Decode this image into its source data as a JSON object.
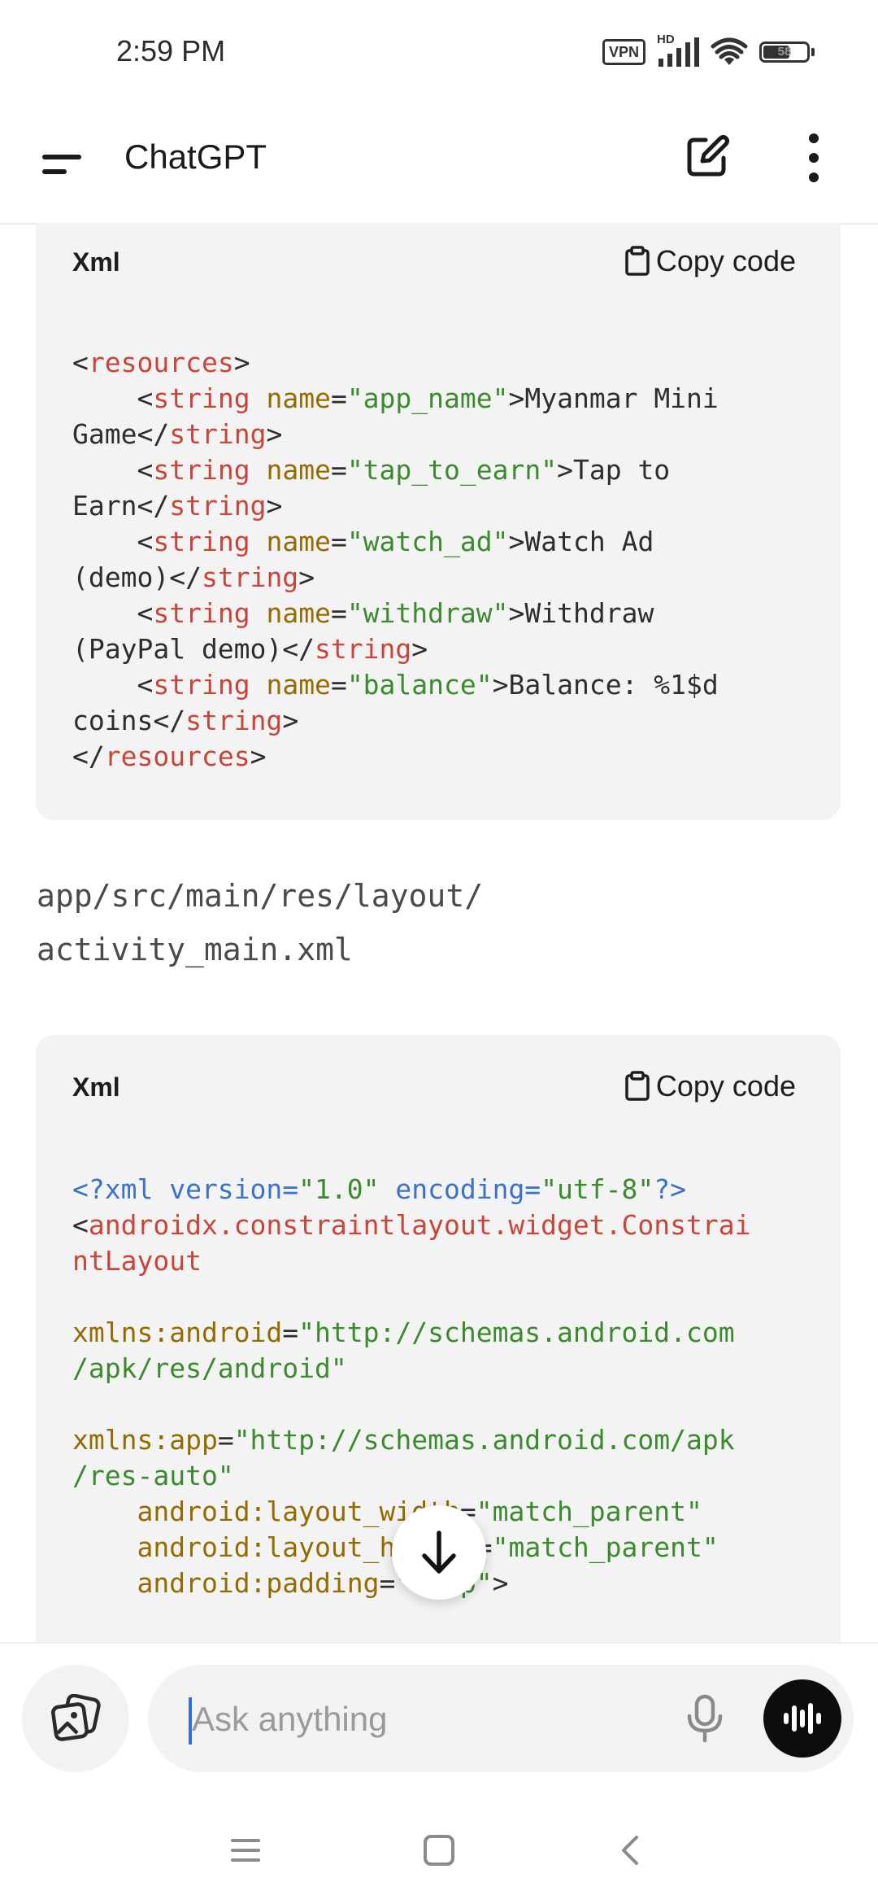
{
  "status_bar": {
    "time": "2:59 PM",
    "vpn_label": "VPN",
    "network_label": "HD",
    "battery_level": "58"
  },
  "header": {
    "title": "ChatGPT",
    "menu_icon": "menu-icon",
    "new_chat_icon": "edit-icon",
    "more_icon": "more-vertical-icon"
  },
  "code_blocks": [
    {
      "language": "Xml",
      "copy_label": "Copy code",
      "lines": [
        [
          [
            "punc",
            "<"
          ],
          [
            "tag",
            "resources"
          ],
          [
            "punc",
            ">"
          ]
        ],
        [
          [
            "text",
            "    "
          ],
          [
            "punc",
            "<"
          ],
          [
            "tag",
            "string"
          ],
          [
            "text",
            " "
          ],
          [
            "attr",
            "name"
          ],
          [
            "punc",
            "="
          ],
          [
            "str",
            "\"app_name\""
          ],
          [
            "punc",
            ">"
          ],
          [
            "text",
            "Myanmar Mini"
          ]
        ],
        [
          [
            "text",
            "Game"
          ],
          [
            "punc",
            "</"
          ],
          [
            "tag",
            "string"
          ],
          [
            "punc",
            ">"
          ]
        ],
        [
          [
            "text",
            "    "
          ],
          [
            "punc",
            "<"
          ],
          [
            "tag",
            "string"
          ],
          [
            "text",
            " "
          ],
          [
            "attr",
            "name"
          ],
          [
            "punc",
            "="
          ],
          [
            "str",
            "\"tap_to_earn\""
          ],
          [
            "punc",
            ">"
          ],
          [
            "text",
            "Tap to"
          ]
        ],
        [
          [
            "text",
            "Earn"
          ],
          [
            "punc",
            "</"
          ],
          [
            "tag",
            "string"
          ],
          [
            "punc",
            ">"
          ]
        ],
        [
          [
            "text",
            "    "
          ],
          [
            "punc",
            "<"
          ],
          [
            "tag",
            "string"
          ],
          [
            "text",
            " "
          ],
          [
            "attr",
            "name"
          ],
          [
            "punc",
            "="
          ],
          [
            "str",
            "\"watch_ad\""
          ],
          [
            "punc",
            ">"
          ],
          [
            "text",
            "Watch Ad"
          ]
        ],
        [
          [
            "text",
            "(demo)"
          ],
          [
            "punc",
            "</"
          ],
          [
            "tag",
            "string"
          ],
          [
            "punc",
            ">"
          ]
        ],
        [
          [
            "text",
            "    "
          ],
          [
            "punc",
            "<"
          ],
          [
            "tag",
            "string"
          ],
          [
            "text",
            " "
          ],
          [
            "attr",
            "name"
          ],
          [
            "punc",
            "="
          ],
          [
            "str",
            "\"withdraw\""
          ],
          [
            "punc",
            ">"
          ],
          [
            "text",
            "Withdraw"
          ]
        ],
        [
          [
            "text",
            "(PayPal demo)"
          ],
          [
            "punc",
            "</"
          ],
          [
            "tag",
            "string"
          ],
          [
            "punc",
            ">"
          ]
        ],
        [
          [
            "text",
            "    "
          ],
          [
            "punc",
            "<"
          ],
          [
            "tag",
            "string"
          ],
          [
            "text",
            " "
          ],
          [
            "attr",
            "name"
          ],
          [
            "punc",
            "="
          ],
          [
            "str",
            "\"balance\""
          ],
          [
            "punc",
            ">"
          ],
          [
            "text",
            "Balance: %1$d"
          ]
        ],
        [
          [
            "text",
            "coins"
          ],
          [
            "punc",
            "</"
          ],
          [
            "tag",
            "string"
          ],
          [
            "punc",
            ">"
          ]
        ],
        [
          [
            "punc",
            "</"
          ],
          [
            "tag",
            "resources"
          ],
          [
            "punc",
            ">"
          ]
        ]
      ]
    },
    {
      "language": "Xml",
      "copy_label": "Copy code",
      "lines": [
        [
          [
            "decl",
            "<?xml version="
          ],
          [
            "str",
            "\"1.0\""
          ],
          [
            "decl",
            " encoding="
          ],
          [
            "str",
            "\"utf-8\""
          ],
          [
            "decl",
            "?>"
          ]
        ],
        [
          [
            "punc",
            "<"
          ],
          [
            "tag",
            "androidx.constraintlayout.widget.Constrai"
          ]
        ],
        [
          [
            "tag",
            "ntLayout"
          ]
        ],
        [
          [
            "text",
            ""
          ]
        ],
        [
          [
            "attr",
            "xmlns:android"
          ],
          [
            "punc",
            "="
          ],
          [
            "str",
            "\"http://schemas.android.com"
          ]
        ],
        [
          [
            "str",
            "/apk/res/android\""
          ]
        ],
        [
          [
            "text",
            ""
          ]
        ],
        [
          [
            "attr",
            "xmlns:app"
          ],
          [
            "punc",
            "="
          ],
          [
            "str",
            "\"http://schemas.android.com/apk"
          ]
        ],
        [
          [
            "str",
            "/res-auto\""
          ]
        ],
        [
          [
            "text",
            "    "
          ],
          [
            "attr",
            "android:layout_width"
          ],
          [
            "punc",
            "="
          ],
          [
            "str",
            "\"match_parent\""
          ]
        ],
        [
          [
            "text",
            "    "
          ],
          [
            "attr",
            "android:layout_height"
          ],
          [
            "punc",
            "="
          ],
          [
            "str",
            "\"match_parent\""
          ]
        ],
        [
          [
            "text",
            "    "
          ],
          [
            "attr",
            "android:padding"
          ],
          [
            "punc",
            "="
          ],
          [
            "str",
            "\"16dp\""
          ],
          [
            "punc",
            ">"
          ]
        ]
      ]
    }
  ],
  "file_path": "app/src/main/res/layout/\nactivity_main.xml",
  "scroll_icon": "arrow-down-icon",
  "composer": {
    "placeholder": "Ask anything",
    "value": "",
    "attach_icon": "image-attach-icon",
    "mic_icon": "microphone-icon",
    "voice_icon": "voice-mode-icon"
  },
  "nav_bar": {
    "recents_icon": "recents-icon",
    "home_icon": "home-icon",
    "back_icon": "back-icon"
  }
}
